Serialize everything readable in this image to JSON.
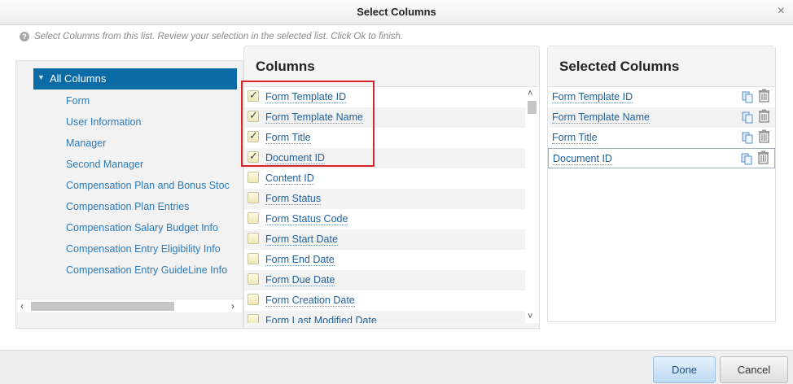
{
  "dialog": {
    "title": "Select Columns",
    "close_glyph": "×",
    "hint": "Select Columns from this list. Review your selection in the selected list. Click Ok to finish."
  },
  "tree": {
    "root_label": "All Columns",
    "items": [
      {
        "label": "Form"
      },
      {
        "label": "User Information"
      },
      {
        "label": "Manager"
      },
      {
        "label": "Second Manager"
      },
      {
        "label": "Compensation Plan and Bonus Stoc"
      },
      {
        "label": "Compensation Plan Entries"
      },
      {
        "label": "Compensation Salary Budget Info"
      },
      {
        "label": "Compensation Entry Eligibility Info"
      },
      {
        "label": "Compensation Entry GuideLine Info"
      }
    ]
  },
  "columns_panel": {
    "heading": "Columns",
    "rows": [
      {
        "label": "Form Template ID",
        "checked": true
      },
      {
        "label": "Form Template Name",
        "checked": true
      },
      {
        "label": "Form Title",
        "checked": true
      },
      {
        "label": "Document ID",
        "checked": true
      },
      {
        "label": "Content ID",
        "checked": false
      },
      {
        "label": "Form Status",
        "checked": false
      },
      {
        "label": "Form Status Code",
        "checked": false
      },
      {
        "label": "Form Start Date",
        "checked": false
      },
      {
        "label": "Form End Date",
        "checked": false
      },
      {
        "label": "Form Due Date",
        "checked": false
      },
      {
        "label": "Form Creation Date",
        "checked": false
      },
      {
        "label": "Form Last Modified Date",
        "checked": false
      }
    ]
  },
  "selected_panel": {
    "heading": "Selected Columns",
    "rows": [
      {
        "label": "Form Template ID"
      },
      {
        "label": "Form Template Name"
      },
      {
        "label": "Form Title"
      },
      {
        "label": "Document ID"
      }
    ]
  },
  "footer": {
    "done_label": "Done",
    "cancel_label": "Cancel"
  },
  "colors": {
    "tree_selected_bg": "#0a6ba6",
    "link": "#1f5f9a",
    "highlight_box": "#d5252b"
  },
  "icons": {
    "hint": "help-icon",
    "close": "close-icon",
    "tree_expand": "triangle-down-icon",
    "checkbox": "checkbox-icon",
    "copy": "copy-icon",
    "delete": "trash-icon"
  }
}
